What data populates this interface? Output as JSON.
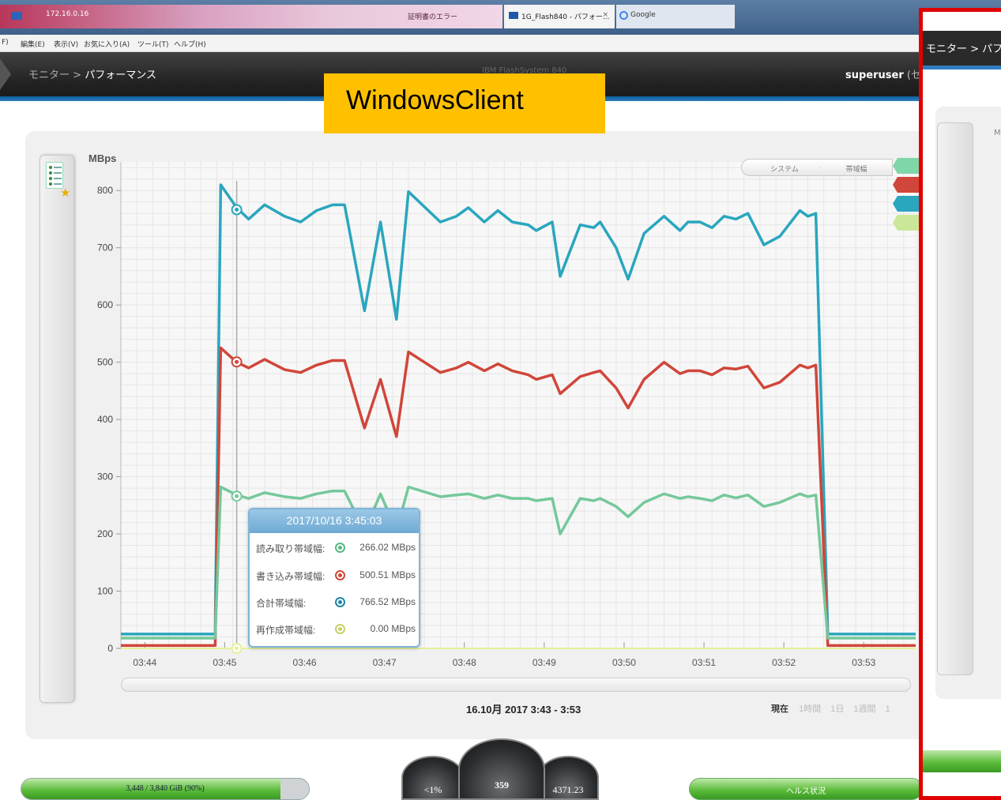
{
  "browser": {
    "tab_address": "172.16.0.16",
    "search_tab": "証明書のエラー",
    "active_tab": "1G_Flash840 - パフォー...",
    "google_tab": "Google",
    "menu": [
      "編集(E)",
      "表示(V)",
      "お気に入り(A)",
      "ツール(T)",
      "ヘルプ(H)"
    ],
    "menu_first": "F)"
  },
  "header": {
    "breadcrumb_parent": "モニター",
    "breadcrumb_sep": ">",
    "breadcrumb_current": "パフォーマンス",
    "product": "IBM FlashSystem 840",
    "user": "superuser",
    "user_role": "(セキュリ"
  },
  "overlay": {
    "label": "WindowsClient",
    "right_breadcrumb": "モニター > パフ",
    "right_m": "M"
  },
  "chart_data": {
    "type": "line",
    "ylabel": "MBps",
    "ylim": [
      0,
      850
    ],
    "yticks": [
      0,
      100,
      200,
      300,
      400,
      500,
      600,
      700,
      800
    ],
    "xlim": [
      0,
      9.95
    ],
    "xticks": [
      "03:44",
      "03:45",
      "03:46",
      "03:47",
      "03:48",
      "03:49",
      "03:50",
      "03:51",
      "03:52",
      "03:53"
    ],
    "colors": {
      "total": "#2aa6be",
      "write": "#d0463a",
      "read": "#75c89b",
      "rebuild": "#e7ef9a"
    },
    "series": [
      {
        "key": "total",
        "x": [
          0,
          0.8,
          0.92,
          1.18,
          1.25,
          1.45,
          1.6,
          1.8,
          2.05,
          2.25,
          2.45,
          2.65,
          2.8,
          3.05,
          3.25,
          3.45,
          3.6,
          4.0,
          4.2,
          4.35,
          4.55,
          4.72,
          4.9,
          5.1,
          5.2,
          5.4,
          5.5,
          5.75,
          5.92,
          6.0,
          6.2,
          6.35,
          6.55,
          6.8,
          7.0,
          7.1,
          7.25,
          7.4,
          7.55,
          7.7,
          7.85,
          8.05,
          8.25,
          8.5,
          8.6,
          8.7,
          8.85,
          9.0,
          9.5,
          9.95
        ],
        "y": [
          25,
          25,
          25,
          25,
          810,
          770,
          750,
          775,
          755,
          745,
          765,
          775,
          775,
          590,
          745,
          575,
          798,
          745,
          755,
          770,
          745,
          765,
          745,
          740,
          730,
          745,
          650,
          740,
          735,
          745,
          700,
          645,
          725,
          755,
          730,
          745,
          745,
          735,
          755,
          750,
          760,
          705,
          720,
          765,
          755,
          760,
          25,
          25,
          25,
          25
        ],
        "label_overrides": {}
      },
      {
        "key": "write",
        "x": [
          0,
          0.8,
          0.92,
          1.18,
          1.25,
          1.45,
          1.6,
          1.8,
          2.05,
          2.25,
          2.45,
          2.65,
          2.8,
          3.05,
          3.25,
          3.45,
          3.6,
          4.0,
          4.2,
          4.35,
          4.55,
          4.72,
          4.9,
          5.1,
          5.2,
          5.4,
          5.5,
          5.75,
          5.92,
          6.0,
          6.2,
          6.35,
          6.55,
          6.8,
          7.0,
          7.1,
          7.25,
          7.4,
          7.55,
          7.7,
          7.85,
          8.05,
          8.25,
          8.5,
          8.6,
          8.7,
          8.85,
          9.0,
          9.5,
          9.95
        ],
        "y": [
          5,
          5,
          5,
          5,
          525,
          500,
          490,
          505,
          487,
          482,
          495,
          503,
          503,
          385,
          470,
          370,
          518,
          482,
          490,
          500,
          485,
          497,
          485,
          478,
          470,
          478,
          445,
          475,
          482,
          485,
          455,
          420,
          470,
          500,
          480,
          485,
          485,
          478,
          490,
          488,
          493,
          455,
          465,
          495,
          490,
          495,
          5,
          5,
          5,
          5
        ]
      },
      {
        "key": "read",
        "x": [
          0,
          0.8,
          0.92,
          1.18,
          1.25,
          1.45,
          1.6,
          1.8,
          2.05,
          2.25,
          2.45,
          2.65,
          2.8,
          3.05,
          3.25,
          3.45,
          3.6,
          4.0,
          4.2,
          4.35,
          4.55,
          4.72,
          4.9,
          5.1,
          5.2,
          5.4,
          5.5,
          5.75,
          5.92,
          6.0,
          6.2,
          6.35,
          6.55,
          6.8,
          7.0,
          7.1,
          7.25,
          7.4,
          7.55,
          7.7,
          7.85,
          8.05,
          8.25,
          8.5,
          8.6,
          8.7,
          8.85,
          9.0,
          9.5,
          9.95
        ],
        "y": [
          18,
          18,
          18,
          18,
          282,
          268,
          262,
          272,
          265,
          262,
          270,
          275,
          275,
          205,
          270,
          205,
          282,
          265,
          268,
          270,
          262,
          268,
          262,
          262,
          258,
          262,
          200,
          262,
          258,
          262,
          248,
          230,
          255,
          270,
          262,
          265,
          262,
          258,
          268,
          263,
          268,
          248,
          255,
          270,
          265,
          268,
          18,
          18,
          18,
          18
        ]
      },
      {
        "key": "rebuild",
        "x": [
          0,
          9.95
        ],
        "y": [
          0,
          0
        ]
      }
    ],
    "cursor_x": 1.45
  },
  "controls": {
    "btn_system": "システム",
    "btn_bandwidth": "帯域幅",
    "legend_colors": [
      "#7fd6a8",
      "#d0463a",
      "#2aa6be",
      "#cbe79a"
    ]
  },
  "tooltip": {
    "title": "2017/10/16 3:45:03",
    "rows": [
      {
        "label": "読み取り帯域幅:",
        "value": "266.02 MBps",
        "color": "#58b981"
      },
      {
        "label": "書き込み帯域幅:",
        "value": "500.51 MBps",
        "color": "#d0463a"
      },
      {
        "label": "合計帯域幅:",
        "value": "766.52 MBps",
        "color": "#1e86a3"
      },
      {
        "label": "再作成帯域幅:",
        "value": "0.00 MBps",
        "color": "#c7d06a"
      }
    ]
  },
  "footer": {
    "date_range": "16.10月 2017 3:43 - 3:53",
    "range_current": "現在",
    "ranges": [
      "1時間",
      "1日",
      "1週間",
      "1"
    ]
  },
  "status": {
    "capacity": "3,448 / 3,840 GiB (90%)",
    "capacity_fraction": 0.9,
    "gauge_left": "<1%",
    "gauge_mid": "359",
    "gauge_right": "4371.23",
    "health": "ヘルス状況"
  }
}
